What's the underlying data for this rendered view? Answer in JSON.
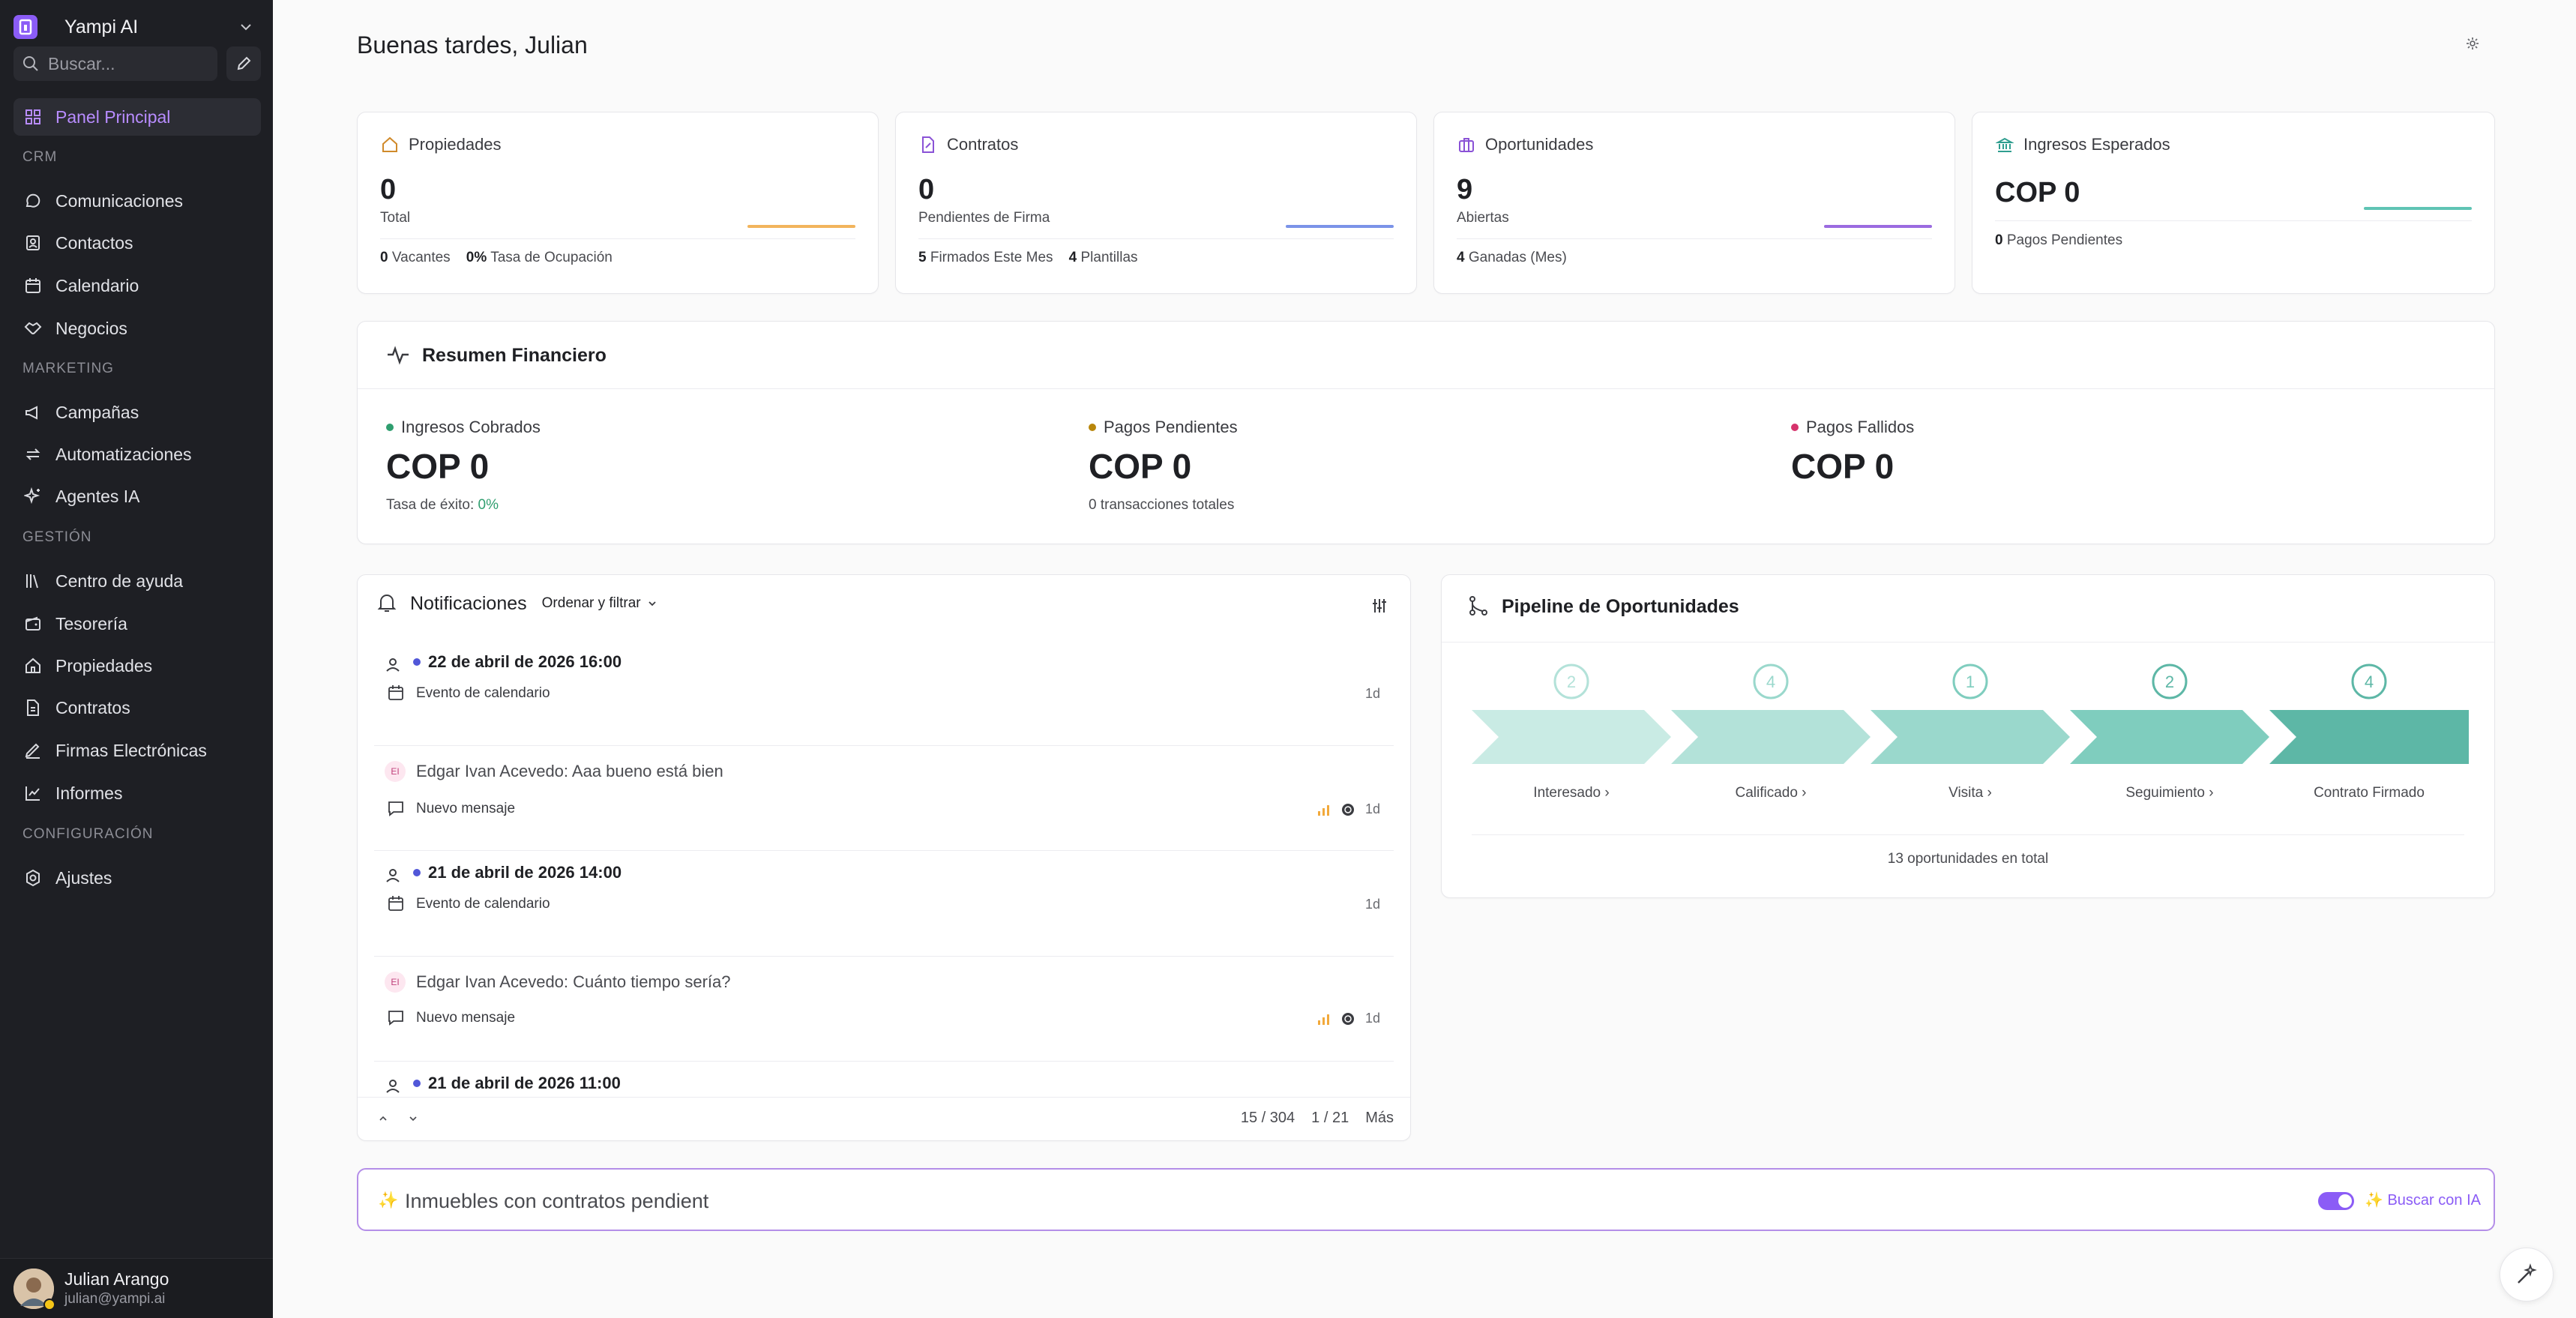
{
  "workspace": {
    "name": "Yampi AI"
  },
  "search": {
    "placeholder": "Buscar..."
  },
  "nav": {
    "panel": "Panel Principal",
    "sec_crm": "CRM",
    "comunicaciones": "Comunicaciones",
    "contactos": "Contactos",
    "calendario": "Calendario",
    "negocios": "Negocios",
    "sec_marketing": "MARKETING",
    "campanas": "Campañas",
    "automatizaciones": "Automatizaciones",
    "agentes": "Agentes IA",
    "sec_gestion": "GESTIÓN",
    "ayuda": "Centro de ayuda",
    "tesoreria": "Tesorería",
    "propiedades": "Propiedades",
    "contratos": "Contratos",
    "firmas": "Firmas Electrónicas",
    "informes": "Informes",
    "sec_config": "CONFIGURACIÓN",
    "ajustes": "Ajustes"
  },
  "user": {
    "name": "Julian Arango",
    "email": "julian@yampi.ai"
  },
  "greeting": "Buenas tardes, Julian",
  "stats": [
    {
      "title": "Propiedades",
      "value": "0",
      "sub": "Total",
      "foot": [
        {
          "n": "0",
          "t": "Vacantes"
        },
        {
          "n": "0%",
          "t": "Tasa de Ocupación"
        }
      ]
    },
    {
      "title": "Contratos",
      "value": "0",
      "sub": "Pendientes de Firma",
      "foot": [
        {
          "n": "5",
          "t": "Firmados Este Mes"
        },
        {
          "n": "4",
          "t": "Plantillas"
        }
      ]
    },
    {
      "title": "Oportunidades",
      "value": "9",
      "sub": "Abiertas",
      "foot": [
        {
          "n": "4",
          "t": "Ganadas (Mes)"
        }
      ]
    },
    {
      "title": "Ingresos Esperados",
      "value": "COP 0",
      "foot": [
        {
          "n": "0",
          "t": "Pagos Pendientes"
        }
      ]
    }
  ],
  "colors": {
    "orange": "#f2b45c",
    "blue": "#7b93e8",
    "purple": "#9b6be0",
    "teal": "#5fc4b4",
    "green_dot": "#2f9e6f",
    "brown_dot": "#b8860b",
    "red_dot": "#d6336c"
  },
  "financial": {
    "title": "Resumen Financiero",
    "cobrados": {
      "label": "Ingresos Cobrados",
      "amount": "COP 0",
      "note_prefix": "Tasa de éxito: ",
      "note_value": "0%"
    },
    "pendientes": {
      "label": "Pagos Pendientes",
      "amount": "COP 0",
      "note": "0 transacciones totales"
    },
    "fallidos": {
      "label": "Pagos Fallidos",
      "amount": "COP 0"
    }
  },
  "notifications": {
    "title": "Notificaciones",
    "sort_label": "Ordenar y filtrar",
    "items": [
      {
        "kind": "event",
        "date": "22 de abril de 2026 16:00",
        "type": "Evento de calendario",
        "age": "1d"
      },
      {
        "kind": "message",
        "sender": "Edgar Ivan Acevedo:",
        "text": " Aaa bueno está bien",
        "initials": "EI",
        "type": "Nuevo mensaje",
        "age": "1d"
      },
      {
        "kind": "event",
        "date": "21 de abril de 2026 14:00",
        "type": "Evento de calendario",
        "age": "1d"
      },
      {
        "kind": "message",
        "sender": "Edgar Ivan Acevedo:",
        "text": " Cuánto tiempo sería?",
        "initials": "EI",
        "type": "Nuevo mensaje",
        "age": "1d"
      },
      {
        "kind": "event",
        "date": "21 de abril de 2026 11:00"
      }
    ],
    "footer": {
      "count": "15 / 304",
      "page": "1 / 21",
      "more": "Más"
    }
  },
  "pipeline": {
    "title": "Pipeline de Oportunidades",
    "stages": [
      {
        "name": "Interesado",
        "count": "2"
      },
      {
        "name": "Calificado",
        "count": "4"
      },
      {
        "name": "Visita",
        "count": "1"
      },
      {
        "name": "Seguimiento",
        "count": "2"
      },
      {
        "name": "Contrato Firmado",
        "count": "4"
      }
    ],
    "stage_colors": [
      "#c9ebe4",
      "#b3e2d9",
      "#9ad8cc",
      "#7fcdbe",
      "#5db7a6"
    ],
    "total": "13 oportunidades en total"
  },
  "ai": {
    "query": "Inmuebles con contratos pendient",
    "button": "✨ Buscar con IA",
    "spark": "✨"
  }
}
